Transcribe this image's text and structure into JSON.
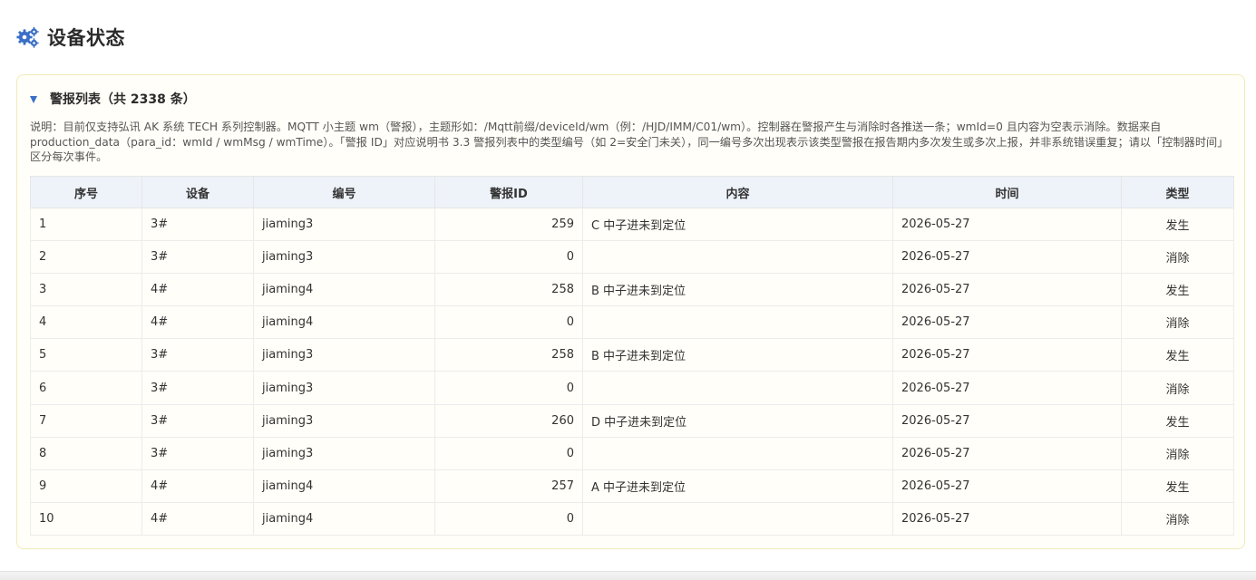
{
  "header": {
    "title": "设备状态",
    "icon": "gears-icon",
    "accent_color": "#3a6fc6"
  },
  "panel": {
    "title": "警报列表（共 2338 条）",
    "collapse_icon": "triangle-down-icon",
    "description": "说明：目前仅支持弘讯 AK 系统 TECH 系列控制器。MQTT 小主题 wm（警报），主题形如：/Mqtt前缀/deviceId/wm（例：/HJD/IMM/C01/wm）。控制器在警报产生与消除时各推送一条；wmId=0 且内容为空表示消除。数据来自 production_data（para_id：wmId / wmMsg / wmTime）。「警报 ID」对应说明书 3.3 警报列表中的类型编号（如 2=安全门未关），同一编号多次出现表示该类型警报在报告期内多次发生或多次上报，并非系统错误重复；请以「控制器时间」区分每次事件。"
  },
  "table": {
    "columns": [
      "序号",
      "设备",
      "编号",
      "警报ID",
      "内容",
      "时间",
      "类型"
    ],
    "rows": [
      [
        "1",
        "3#",
        "jiaming3",
        "259",
        "C 中子进未到定位",
        "2026-05-27",
        "发生"
      ],
      [
        "2",
        "3#",
        "jiaming3",
        "0",
        "",
        "2026-05-27",
        "消除"
      ],
      [
        "3",
        "4#",
        "jiaming4",
        "258",
        "B 中子进未到定位",
        "2026-05-27",
        "发生"
      ],
      [
        "4",
        "4#",
        "jiaming4",
        "0",
        "",
        "2026-05-27",
        "消除"
      ],
      [
        "5",
        "3#",
        "jiaming3",
        "258",
        "B 中子进未到定位",
        "2026-05-27",
        "发生"
      ],
      [
        "6",
        "3#",
        "jiaming3",
        "0",
        "",
        "2026-05-27",
        "消除"
      ],
      [
        "7",
        "3#",
        "jiaming3",
        "260",
        "D 中子进未到定位",
        "2026-05-27",
        "发生"
      ],
      [
        "8",
        "3#",
        "jiaming3",
        "0",
        "",
        "2026-05-27",
        "消除"
      ],
      [
        "9",
        "4#",
        "jiaming4",
        "257",
        "A 中子进未到定位",
        "2026-05-27",
        "发生"
      ],
      [
        "10",
        "4#",
        "jiaming4",
        "0",
        "",
        "2026-05-27",
        "消除"
      ]
    ]
  }
}
